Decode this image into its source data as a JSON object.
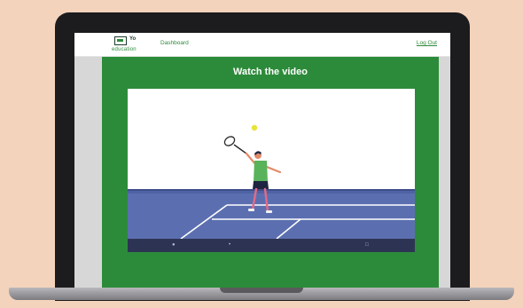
{
  "header": {
    "logo_text": "education",
    "logo_mark": "Yo",
    "nav_dashboard": "Dashboard",
    "nav_logout": "Log Out"
  },
  "main": {
    "title": "Watch the video"
  },
  "video": {
    "scene": "tennis-player-serving-icon",
    "controls": [
      "play-icon",
      "volume-icon",
      "fullscreen-icon"
    ]
  },
  "colors": {
    "background": "#f3d3bc",
    "primary_green": "#2c8b3a",
    "court_blue": "#4f63a4",
    "control_bar": "#2d3453"
  }
}
